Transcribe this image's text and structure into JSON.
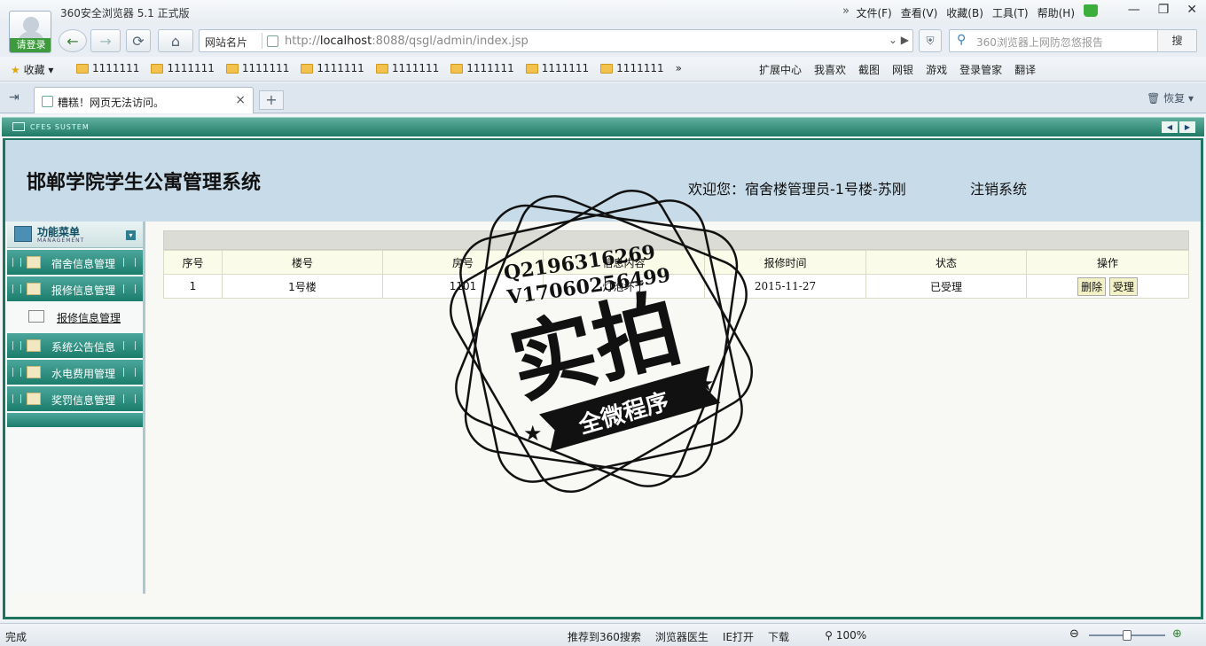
{
  "browser": {
    "title": "360安全浏览器 5.1 正式版",
    "login_label": "请登录",
    "menu": [
      "文件(F)",
      "查看(V)",
      "收藏(B)",
      "工具(T)",
      "帮助(H)"
    ],
    "window_buttons": {
      "minimize": "—",
      "restore": "❐",
      "close": "✕"
    },
    "site_card": "网站名片",
    "url_scheme": "http://",
    "url_host": "localhost",
    "url_path": ":8088/qsgl/admin/index.jsp",
    "search_placeholder": "360浏览器上网防忽悠报告",
    "search_button": "搜",
    "favorites_label": "收藏",
    "bookmarks": [
      "1111111",
      "1111111",
      "1111111",
      "1111111",
      "1111111",
      "1111111",
      "1111111",
      "1111111",
      "1111111"
    ],
    "bookmark_more": "»",
    "tools": [
      "扩展中心",
      "我喜欢",
      "截图",
      "网银",
      "游戏",
      "登录管家",
      "翻译"
    ],
    "tab_title": "糟糕！网页无法访问。",
    "new_tab": "+",
    "restore_label": "恢复",
    "status_text": "完成",
    "status_items": [
      "推荐到360搜索",
      "浏览器医生",
      "IE打开",
      "下载"
    ],
    "zoom": "100%"
  },
  "app": {
    "sys_label": "CFES SUSTEM",
    "site_title": "邯郸学院学生公寓管理系统",
    "welcome": "欢迎您：宿舍楼管理员-1号楼-苏刚",
    "logout": "注销系统",
    "sidebar": {
      "title": "功能菜单",
      "subtitle": "MANAGEMENT",
      "items": [
        "宿舍信息管理",
        "报修信息管理",
        "系统公告信息",
        "水电费用管理",
        "奖罚信息管理"
      ],
      "sub_item": "报修信息管理"
    },
    "table": {
      "headers": [
        "序号",
        "楼号",
        "房号",
        "信息内容",
        "报修时间",
        "状态",
        "操作"
      ],
      "row": {
        "no": "1",
        "building": "1号楼",
        "room": "1101",
        "content": "灯泡坏了",
        "time": "2015-11-27",
        "status": "已受理",
        "delete": "删除",
        "accept": "受理"
      }
    }
  },
  "watermark": {
    "qq": "Q2196316269",
    "v": "V17060256499",
    "big": "实拍",
    "ribbon": "全微程序"
  }
}
